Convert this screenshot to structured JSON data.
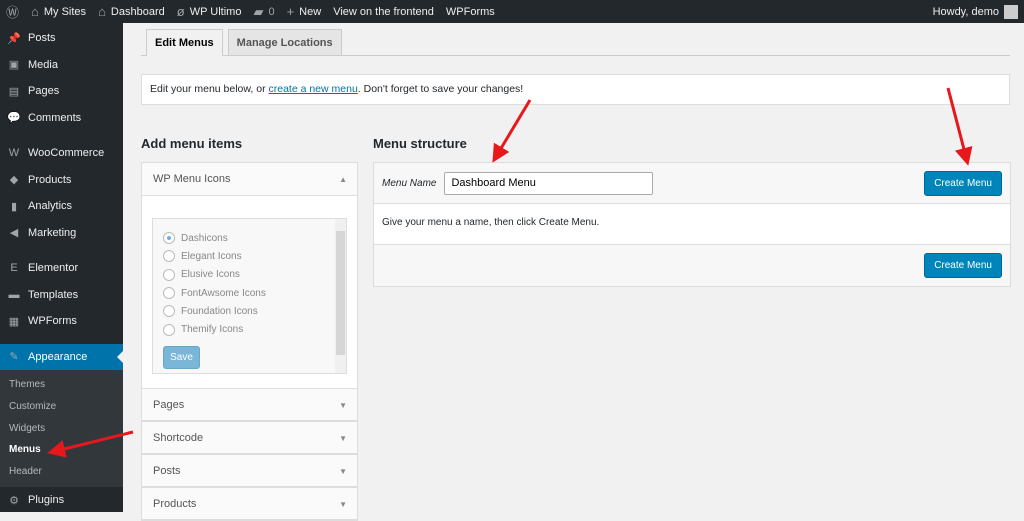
{
  "adminbar": {
    "wp": "W",
    "my_sites": "My Sites",
    "dashboard": "Dashboard",
    "wp_ultimo": "WP Ultimo",
    "comments": "0",
    "new": "New",
    "view": "View on the frontend",
    "wpforms": "WPForms",
    "howdy": "Howdy, demo"
  },
  "sidebar": {
    "items": [
      {
        "label": "Posts",
        "icon": "📌"
      },
      {
        "label": "Media",
        "icon": "▣"
      },
      {
        "label": "Pages",
        "icon": "▤"
      },
      {
        "label": "Comments",
        "icon": "💬"
      },
      {
        "label": "WooCommerce",
        "icon": "W"
      },
      {
        "label": "Products",
        "icon": "◆"
      },
      {
        "label": "Analytics",
        "icon": "▮"
      },
      {
        "label": "Marketing",
        "icon": "◀"
      },
      {
        "label": "Elementor",
        "icon": "E"
      },
      {
        "label": "Templates",
        "icon": "▬"
      },
      {
        "label": "WPForms",
        "icon": "▦"
      },
      {
        "label": "Appearance",
        "icon": "✎"
      },
      {
        "label": "Plugins",
        "icon": "⚙"
      }
    ],
    "sub": [
      "Themes",
      "Customize",
      "Widgets",
      "Menus",
      "Header"
    ]
  },
  "tabs": [
    "Edit Menus",
    "Manage Locations"
  ],
  "notice": {
    "before": "Edit your menu below, or ",
    "link": "create a new menu",
    "after": ". Don't forget to save your changes!"
  },
  "add_items": {
    "title": "Add menu items",
    "panel": "WP Menu Icons",
    "options": [
      "Dashicons",
      "Elegant Icons",
      "Elusive Icons",
      "FontAwsome Icons",
      "Foundation Icons",
      "Themify Icons"
    ],
    "save": "Save",
    "sections": [
      "Pages",
      "Shortcode",
      "Posts",
      "Products"
    ]
  },
  "structure": {
    "title": "Menu structure",
    "name_label": "Menu Name",
    "name_value": "Dashboard Menu",
    "create": "Create Menu",
    "hint": "Give your menu a name, then click Create Menu."
  },
  "colors": {
    "accent": "#0073aa",
    "arrow": "#e8171b"
  }
}
